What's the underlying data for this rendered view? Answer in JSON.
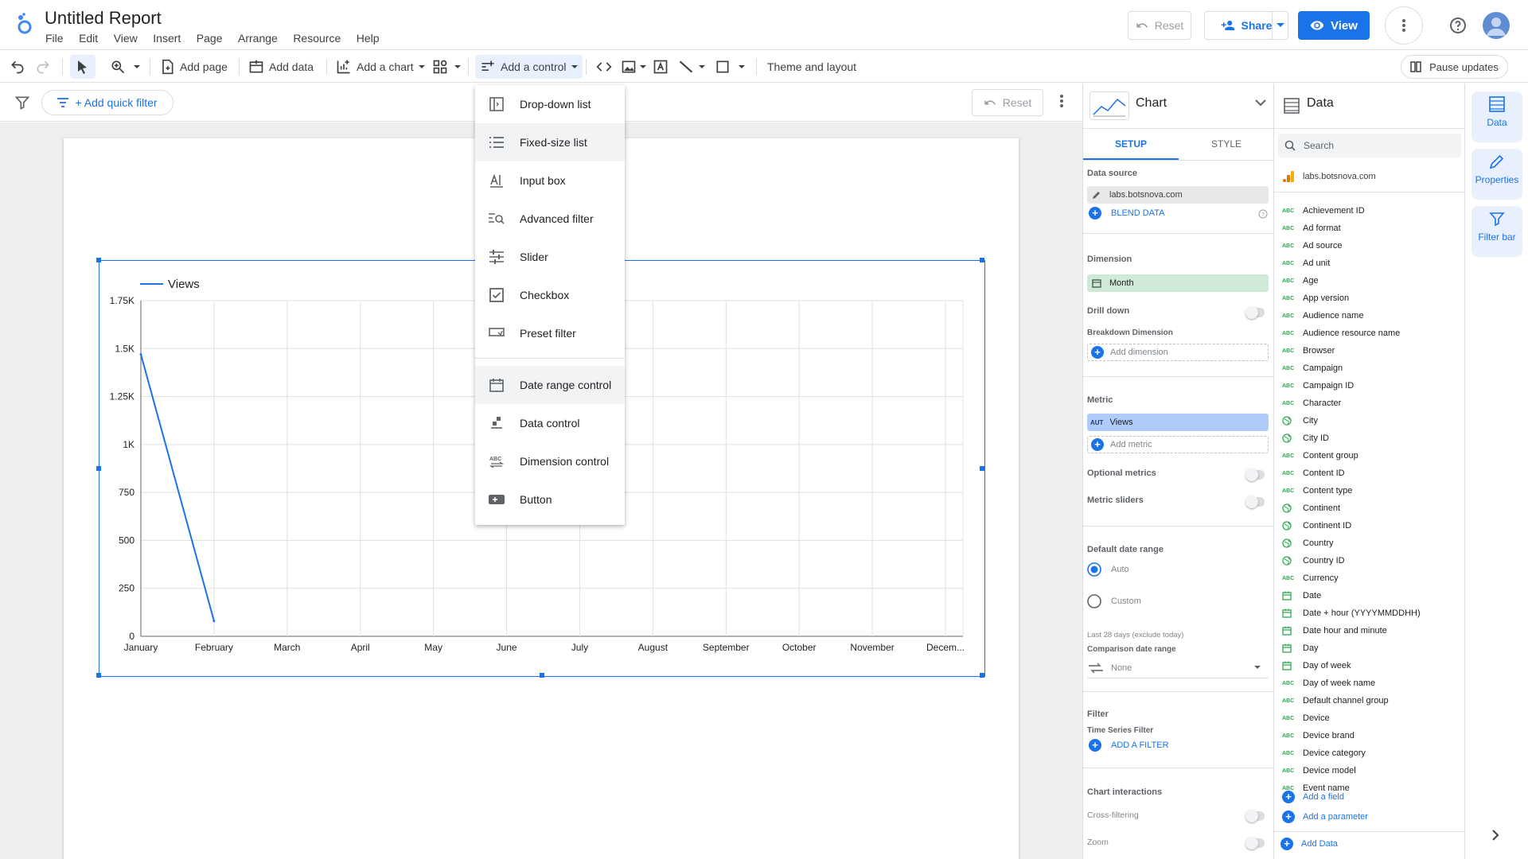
{
  "header": {
    "title": "Untitled Report",
    "menu": [
      "File",
      "Edit",
      "View",
      "Insert",
      "Page",
      "Arrange",
      "Resource",
      "Help"
    ],
    "reset_label": "Reset",
    "share_label": "Share",
    "view_label": "View"
  },
  "toolbar": {
    "add_page": "Add page",
    "add_data": "Add data",
    "add_chart": "Add a chart",
    "add_control": "Add a control",
    "theme_layout": "Theme and layout",
    "pause_updates": "Pause updates"
  },
  "filterbar": {
    "quick_filter": "+ Add quick filter",
    "reset_label": "Reset"
  },
  "control_menu": {
    "items": [
      "Drop-down list",
      "Fixed-size list",
      "Input box",
      "Advanced filter",
      "Slider",
      "Checkbox",
      "Preset filter",
      "Date range control",
      "Data control",
      "Dimension control",
      "Button"
    ]
  },
  "chart_data": {
    "type": "line",
    "categories": [
      "January",
      "February",
      "March",
      "April",
      "May",
      "June",
      "July",
      "August",
      "September",
      "October",
      "November",
      "Decem..."
    ],
    "series": [
      {
        "name": "Views",
        "values": [
          1470,
          80,
          null,
          null,
          null,
          null,
          null,
          null,
          null,
          null,
          null,
          null
        ]
      }
    ],
    "yticks": [
      "0",
      "250",
      "500",
      "750",
      "1K",
      "1.25K",
      "1.5K",
      "1.75K"
    ],
    "ylim": [
      0,
      1750
    ],
    "grid": true,
    "legend": "top-left",
    "color": "#1a73e8"
  },
  "chart_panel": {
    "title": "Chart",
    "tab_setup": "SETUP",
    "tab_style": "STYLE",
    "data_source_label": "Data source",
    "data_source": "labs.botsnova.com",
    "blend": "BLEND DATA",
    "dimension_label": "Dimension",
    "dimension": "Month",
    "drill_down": "Drill down",
    "breakdown_label": "Breakdown Dimension",
    "add_dimension": "Add dimension",
    "metric_label": "Metric",
    "metric_badge": "AUT",
    "metric": "Views",
    "add_metric": "Add metric",
    "optional_metrics": "Optional metrics",
    "metric_sliders": "Metric sliders",
    "default_date_label": "Default date range",
    "auto": "Auto",
    "custom": "Custom",
    "last28": "Last 28 days (exclude today)",
    "comparison_label": "Comparison date range",
    "comparison_value": "None",
    "filter_label": "Filter",
    "ts_filter": "Time Series Filter",
    "add_filter": "ADD A FILTER",
    "interactions_label": "Chart interactions",
    "cross_filtering": "Cross-filtering",
    "zoom": "Zoom"
  },
  "data_panel": {
    "title": "Data",
    "search_placeholder": "Search",
    "source": "labs.botsnova.com",
    "fields": [
      {
        "name": "Achievement ID",
        "type": "abc"
      },
      {
        "name": "Ad format",
        "type": "abc"
      },
      {
        "name": "Ad source",
        "type": "abc"
      },
      {
        "name": "Ad unit",
        "type": "abc"
      },
      {
        "name": "Age",
        "type": "abc"
      },
      {
        "name": "App version",
        "type": "abc"
      },
      {
        "name": "Audience name",
        "type": "abc"
      },
      {
        "name": "Audience resource name",
        "type": "abc"
      },
      {
        "name": "Browser",
        "type": "abc"
      },
      {
        "name": "Campaign",
        "type": "abc"
      },
      {
        "name": "Campaign ID",
        "type": "abc"
      },
      {
        "name": "Character",
        "type": "abc"
      },
      {
        "name": "City",
        "type": "geo"
      },
      {
        "name": "City ID",
        "type": "geo"
      },
      {
        "name": "Content group",
        "type": "abc"
      },
      {
        "name": "Content ID",
        "type": "abc"
      },
      {
        "name": "Content type",
        "type": "abc"
      },
      {
        "name": "Continent",
        "type": "geo"
      },
      {
        "name": "Continent ID",
        "type": "geo"
      },
      {
        "name": "Country",
        "type": "geo"
      },
      {
        "name": "Country ID",
        "type": "geo"
      },
      {
        "name": "Currency",
        "type": "abc"
      },
      {
        "name": "Date",
        "type": "date"
      },
      {
        "name": "Date + hour (YYYYMMDDHH)",
        "type": "date"
      },
      {
        "name": "Date hour and minute",
        "type": "date"
      },
      {
        "name": "Day",
        "type": "date"
      },
      {
        "name": "Day of week",
        "type": "date"
      },
      {
        "name": "Day of week name",
        "type": "abc"
      },
      {
        "name": "Default channel group",
        "type": "abc"
      },
      {
        "name": "Device",
        "type": "abc"
      },
      {
        "name": "Device brand",
        "type": "abc"
      },
      {
        "name": "Device category",
        "type": "abc"
      },
      {
        "name": "Device model",
        "type": "abc"
      },
      {
        "name": "Event name",
        "type": "abc"
      }
    ],
    "add_field": "Add a field",
    "add_parameter": "Add a parameter",
    "add_data": "Add Data"
  },
  "rail": {
    "data": "Data",
    "properties": "Properties",
    "filter_bar": "Filter bar"
  }
}
